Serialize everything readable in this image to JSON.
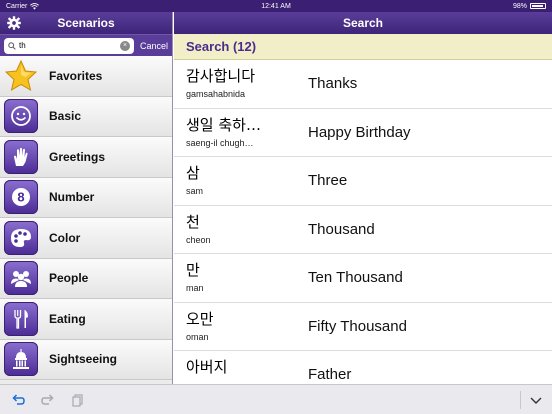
{
  "status": {
    "carrier": "Carrier",
    "time": "12:41 AM",
    "battery": "98%"
  },
  "left": {
    "title": "Scenarios",
    "search": {
      "value": "th",
      "cancel_label": "Cancel"
    },
    "categories": [
      {
        "label": "Favorites",
        "icon": "star-icon"
      },
      {
        "label": "Basic",
        "icon": "smiley-icon"
      },
      {
        "label": "Greetings",
        "icon": "hand-icon"
      },
      {
        "label": "Number",
        "icon": "number-icon"
      },
      {
        "label": "Color",
        "icon": "palette-icon"
      },
      {
        "label": "People",
        "icon": "people-icon"
      },
      {
        "label": "Eating",
        "icon": "utensils-icon"
      },
      {
        "label": "Sightseeing",
        "icon": "building-icon"
      }
    ]
  },
  "right": {
    "title": "Search",
    "result_header": "Search (12)",
    "results": [
      {
        "korean": "감사합니다",
        "romanization": "gamsahabnida",
        "english": "Thanks"
      },
      {
        "korean": "생일 축하…",
        "romanization": "saeng-il chugh…",
        "english": "Happy Birthday"
      },
      {
        "korean": "삼",
        "romanization": "sam",
        "english": "Three"
      },
      {
        "korean": "천",
        "romanization": "cheon",
        "english": "Thousand"
      },
      {
        "korean": "만",
        "romanization": "man",
        "english": "Ten Thousand"
      },
      {
        "korean": "오만",
        "romanization": "oman",
        "english": "Fifty Thousand"
      },
      {
        "korean": "아버지",
        "romanization": "",
        "english": "Father"
      }
    ]
  },
  "colors": {
    "accent": "#4b2b95",
    "header_bg": "#f2efc8"
  }
}
